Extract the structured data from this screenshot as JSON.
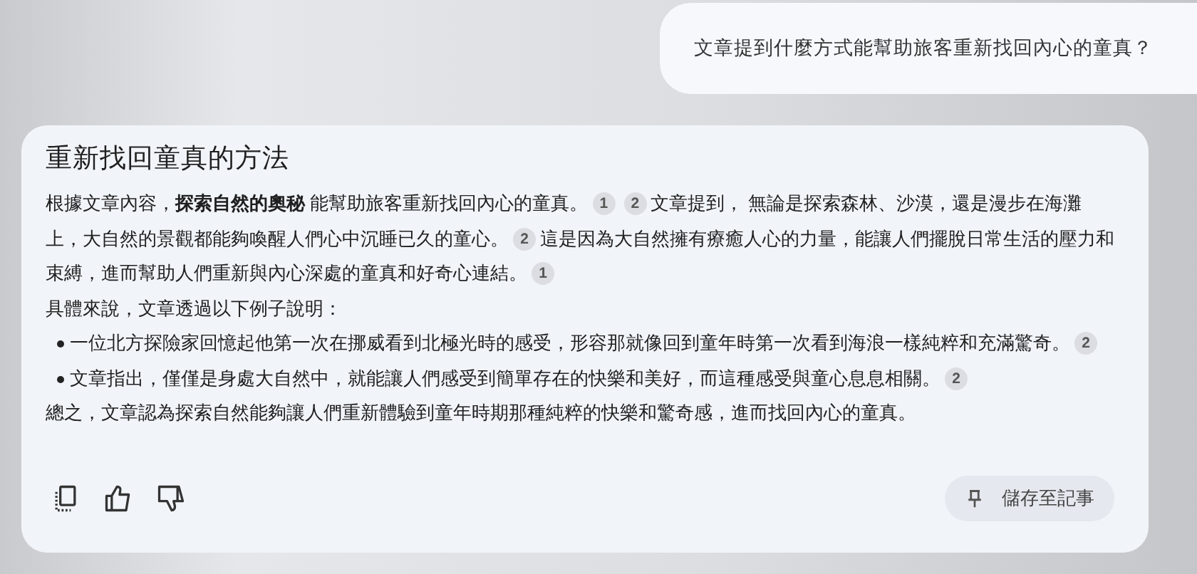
{
  "user_message": "文章提到什麼方式能幫助旅客重新找回內心的童真？",
  "answer": {
    "title": "重新找回童真的方法",
    "blocks": [
      {
        "kind": "paragraph",
        "segments": [
          {
            "text": "根據文章內容，**探索自然的奧秘** 能幫助旅客重新找回內心的童真。"
          },
          {
            "cite": "1"
          },
          {
            "cite": "2"
          },
          {
            "text": "文章提到， 無論是探索森林、沙漠，還是漫步在海灘上，大自然的景觀都能夠喚醒人們心中沉睡已久的童心。"
          },
          {
            "cite": "2"
          },
          {
            "text": "這是因為大自然擁有療癒人心的力量，能讓人們擺脫日常生活的壓力和束縛，進而幫助人們重新與內心深處的童真和好奇心連結。"
          },
          {
            "cite": "1"
          }
        ]
      },
      {
        "kind": "paragraph",
        "segments": [
          {
            "text": "具體來說，文章透過以下例子說明："
          }
        ]
      },
      {
        "kind": "bullet",
        "segments": [
          {
            "text": "一位北方探險家回憶起他第一次在挪威看到北極光時的感受，形容那就像回到童年時第一次看到海浪一樣純粹和充滿驚奇。"
          },
          {
            "cite": "2"
          }
        ]
      },
      {
        "kind": "bullet",
        "segments": [
          {
            "text": "文章指出，僅僅是身處大自然中，就能讓人們感受到簡單存在的快樂和美好，而這種感受與童心息息相關。"
          },
          {
            "cite": "2"
          }
        ]
      },
      {
        "kind": "paragraph",
        "segments": [
          {
            "text": "總之，文章認為探索自然能夠讓人們重新體驗到童年時期那種純粹的快樂和驚奇感，進而找回內心的童真。"
          }
        ]
      }
    ],
    "save_button": "儲存至記事"
  }
}
